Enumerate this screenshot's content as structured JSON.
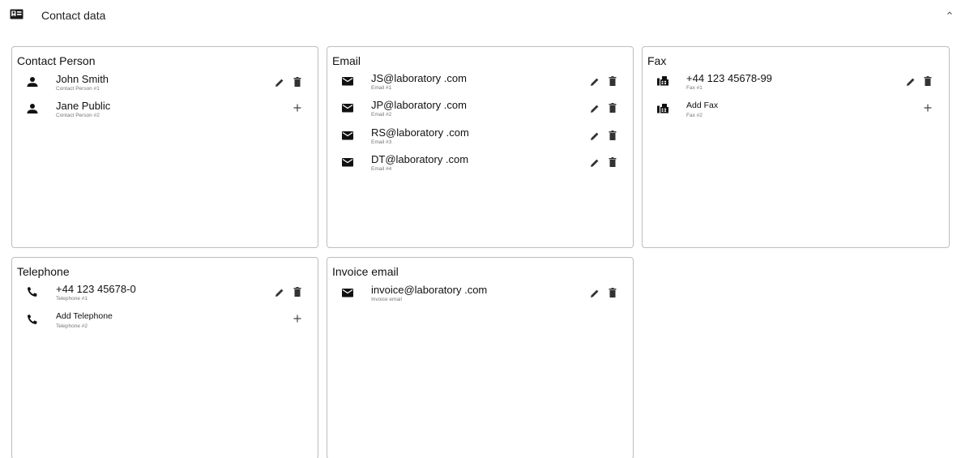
{
  "section": {
    "title": "Contact data",
    "icon": "contact-card-icon",
    "collapse_icon": "chevron-up-icon"
  },
  "cards": {
    "contact_person": {
      "title": "Contact Person",
      "items": [
        {
          "value": "John Smith",
          "caption": "Contact Person #1"
        },
        {
          "value": "Jane Public",
          "caption": "Contact Person #2"
        }
      ]
    },
    "email": {
      "title": "Email",
      "items": [
        {
          "value": "JS@laboratory .com",
          "caption": "Email #1"
        },
        {
          "value": "JP@laboratory .com",
          "caption": "Email #2"
        },
        {
          "value": "RS@laboratory .com",
          "caption": "Email #3"
        },
        {
          "value": "DT@laboratory .com",
          "caption": "Email #4"
        }
      ]
    },
    "fax": {
      "title": "Fax",
      "items": [
        {
          "value": "+44 123 45678-99",
          "caption": "Fax #1"
        },
        {
          "value": "Add Fax",
          "caption": "Fax #2"
        }
      ]
    },
    "telephone": {
      "title": "Telephone",
      "items": [
        {
          "value": "+44 123 45678-0",
          "caption": "Telephone #1"
        },
        {
          "value": "Add Telephone",
          "caption": "Telephone #2"
        }
      ]
    },
    "invoice_email": {
      "title": "Invoice email",
      "items": [
        {
          "value": "invoice@laboratory .com",
          "caption": "Invoice email"
        }
      ]
    }
  },
  "icons": {
    "person": "person-icon",
    "email": "envelope-icon",
    "fax": "fax-icon",
    "telephone": "phone-icon",
    "edit": "pencil-icon",
    "delete": "trash-icon",
    "add": "plus-icon"
  }
}
